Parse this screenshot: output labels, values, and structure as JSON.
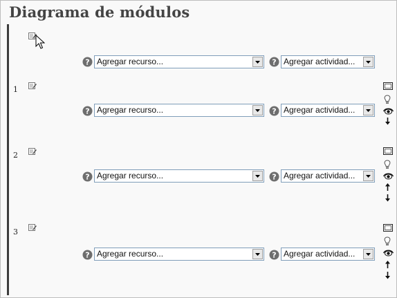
{
  "page": {
    "title": "Diagrama de módulos"
  },
  "sections": [
    {
      "number": "",
      "resource_select": {
        "value": "Agregar recurso..."
      },
      "activity_select": {
        "value": "Agregar actividad..."
      }
    },
    {
      "number": "1",
      "resource_select": {
        "value": "Agregar recurso..."
      },
      "activity_select": {
        "value": "Agregar actividad..."
      }
    },
    {
      "number": "2",
      "resource_select": {
        "value": "Agregar recurso..."
      },
      "activity_select": {
        "value": "Agregar actividad..."
      }
    },
    {
      "number": "3",
      "resource_select": {
        "value": "Agregar recurso..."
      },
      "activity_select": {
        "value": "Agregar actividad..."
      }
    }
  ],
  "icons": {
    "edit": "edit-summary-icon",
    "help": "help-icon",
    "show_only": "show-only-this-section-icon",
    "highlight": "highlight-lightbulb-icon",
    "visibility": "eye-icon",
    "move_up": "arrow-up-icon",
    "move_down": "arrow-down-icon"
  },
  "colors": {
    "background": "#f9f9f9",
    "title": "#444444",
    "select_border": "#7f9db9"
  }
}
